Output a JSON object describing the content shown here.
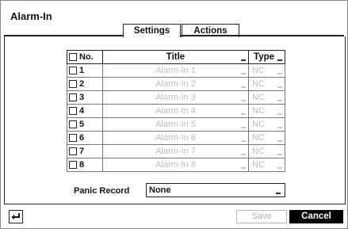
{
  "dialog": {
    "title": "Alarm-In"
  },
  "tabs": [
    {
      "label": "Settings",
      "active": true
    },
    {
      "label": "Actions",
      "active": false
    }
  ],
  "table": {
    "headers": {
      "no": "No.",
      "title": "Title",
      "type": "Type"
    },
    "rows": [
      {
        "no": "1",
        "title": "Alarm-In 1",
        "type": "NC"
      },
      {
        "no": "2",
        "title": "Alarm-In 2",
        "type": "NC"
      },
      {
        "no": "3",
        "title": "Alarm-In 3",
        "type": "NC"
      },
      {
        "no": "4",
        "title": "Alarm-In 4",
        "type": "NC"
      },
      {
        "no": "5",
        "title": "Alarm-In 5",
        "type": "NC"
      },
      {
        "no": "6",
        "title": "Alarm-In 6",
        "type": "NC"
      },
      {
        "no": "7",
        "title": "Alarm-In 7",
        "type": "NC"
      },
      {
        "no": "8",
        "title": "Alarm-In 8",
        "type": "NC"
      }
    ]
  },
  "panic_record": {
    "label": "Panic Record",
    "value": "None"
  },
  "footer": {
    "back_icon": "return-arrow-icon",
    "save_label": "Save",
    "cancel_label": "Cancel"
  },
  "colors": {
    "disabled_text": "#bdbdbd",
    "cancel_bg": "#000000",
    "border": "#222222"
  }
}
